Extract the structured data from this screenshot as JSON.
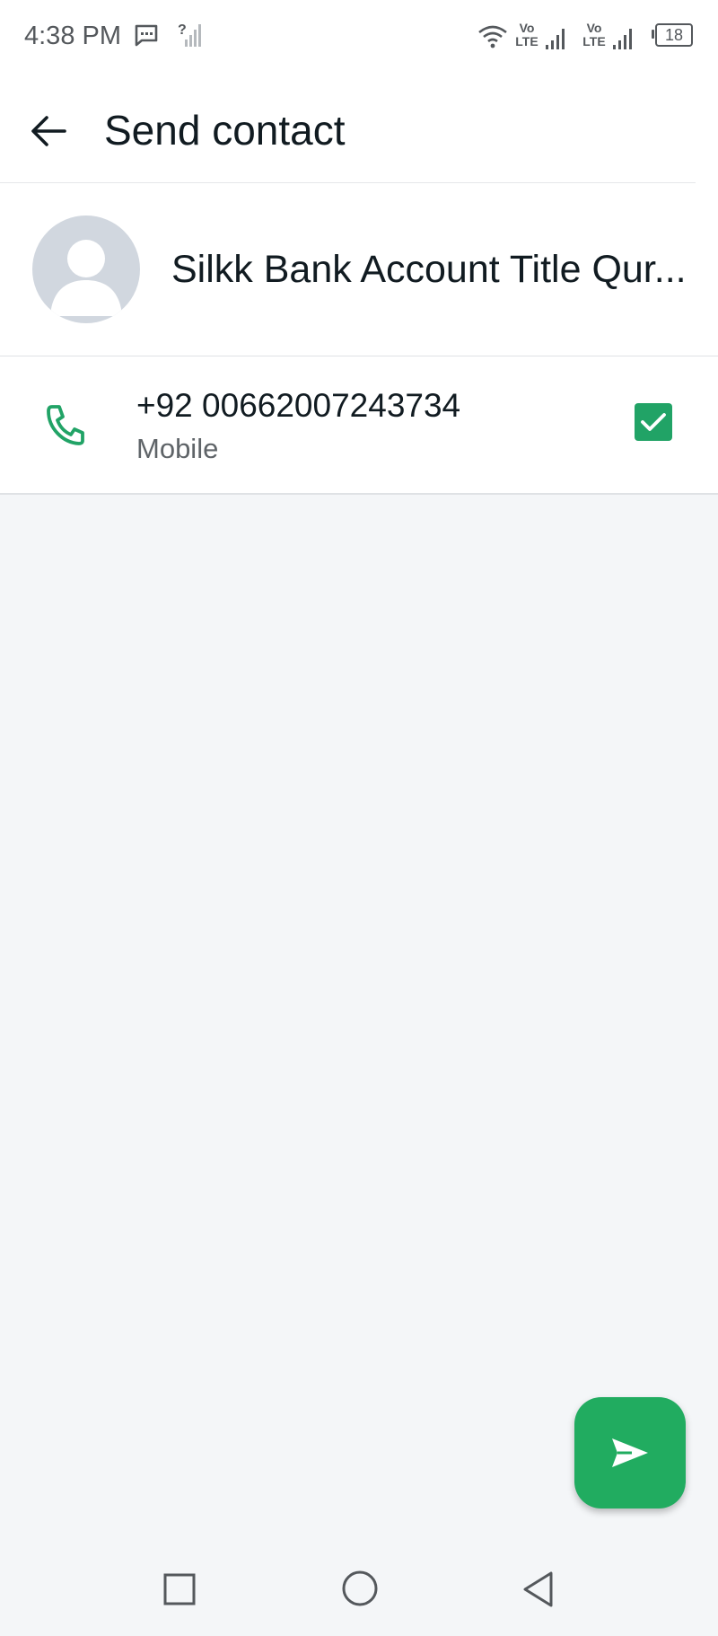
{
  "status_bar": {
    "time": "4:38 PM",
    "sim1_tech": "Vo LTE",
    "sim2_tech": "Vo LTE",
    "battery": "18",
    "icons": [
      "message-icon",
      "no-sim-icon",
      "wifi-icon",
      "signal-icon",
      "signal-icon",
      "battery-icon"
    ]
  },
  "app_bar": {
    "title": "Send contact",
    "back_icon": "arrow-left-icon"
  },
  "contact": {
    "name": "Silkk Bank Account Title Qur..."
  },
  "phone_entries": [
    {
      "number": "+92 00662007243734",
      "type": "Mobile",
      "selected": true,
      "icon": "phone-icon"
    }
  ],
  "send_button": {
    "icon": "send-icon"
  },
  "nav_bar": {
    "items": [
      "recent-apps",
      "home",
      "back"
    ]
  },
  "colors": {
    "accent": "#21a366",
    "fab": "#21ac60",
    "background": "#f4f6f8",
    "surface": "#ffffff",
    "text_primary": "#111b21",
    "text_secondary": "#5f6468"
  }
}
